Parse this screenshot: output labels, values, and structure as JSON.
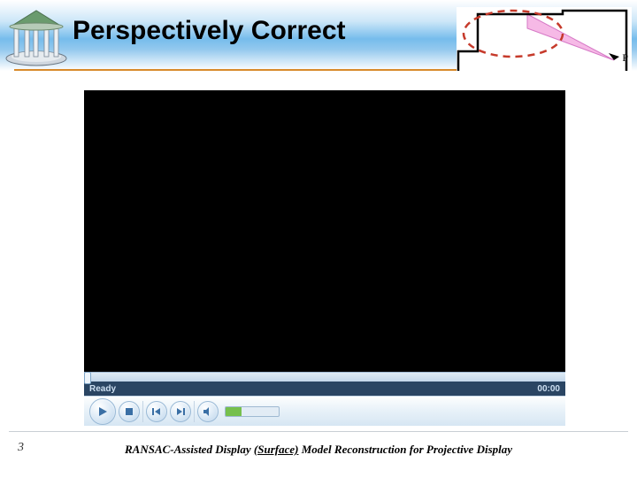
{
  "header": {
    "title": "Perspectively Correct"
  },
  "diagram": {
    "label": "P"
  },
  "media": {
    "status_text": "Ready",
    "time_text": "00:00"
  },
  "footer": {
    "page": "3",
    "prefix": "RANSAC-Assisted Display ",
    "surface": "(Surface)",
    "suffix": " Model Reconstruction for Projective Display"
  }
}
